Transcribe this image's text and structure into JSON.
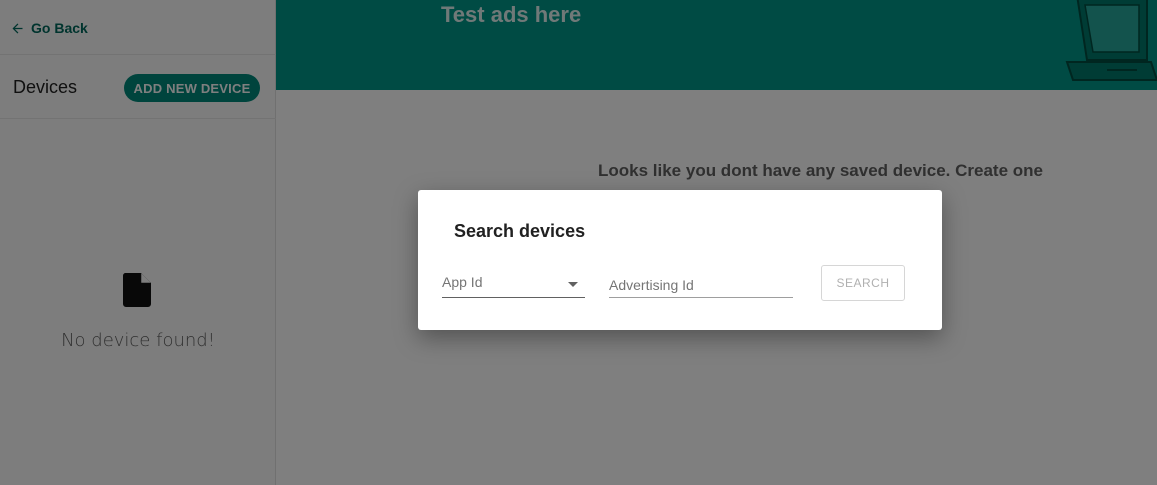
{
  "sidebar": {
    "go_back": "Go Back",
    "title": "Devices",
    "add_button": "ADD NEW DEVICE",
    "empty_text": "No device found!"
  },
  "banner": {
    "title": "Test ads here"
  },
  "main": {
    "empty_message": "Looks like you dont have any saved device. Create one"
  },
  "dialog": {
    "title": "Search devices",
    "app_id_placeholder": "App Id",
    "advertising_id_placeholder": "Advertising Id",
    "search_button": "SEARCH"
  },
  "icons": {
    "back": "arrow-left-icon",
    "empty": "file-icon",
    "dropdown": "caret-down-icon"
  },
  "colors": {
    "accent": "#00897b",
    "banner": "#009688"
  }
}
